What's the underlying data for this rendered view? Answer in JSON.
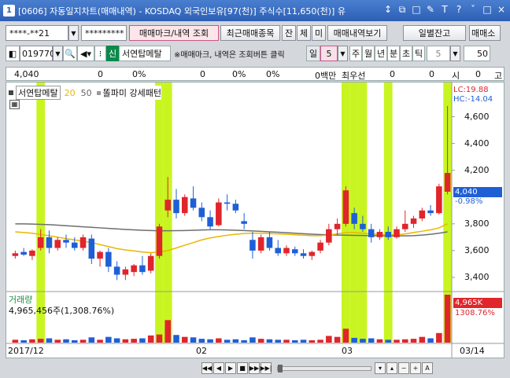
{
  "window": {
    "number": "1",
    "title": "[0606] 자동일지차트(매매내역) - KOSDAQ 외국인보유[97(천)] 주식수[11,650(천)] 유",
    "controls": [
      "↕",
      "⧉",
      "□",
      "✎",
      "T",
      "?",
      "ˇ",
      "□",
      "×"
    ]
  },
  "toolbar1": {
    "account": "****-**21",
    "password": "*********",
    "trade_mark_btn": "매매마크/내역 조회",
    "recent_btn": "최근매매종목",
    "small_btns": [
      "잔",
      "체",
      "미"
    ],
    "trade_list_btn": "매매내역보기",
    "daily_btn": "일별잔고",
    "trade_btn2": "매매소"
  },
  "toolbar2": {
    "code": "019770",
    "badge": "신",
    "name": "서연탑메탈",
    "hint": "※매매마크, 내역은 조회버튼 클릭",
    "period_label": "일",
    "period_value": "5",
    "periods": [
      "주",
      "월",
      "년",
      "분",
      "초",
      "틱"
    ],
    "tick_value": "5",
    "count": "50"
  },
  "infobar": {
    "price": "4,040",
    "v1": "0",
    "p1": "0%",
    "v2": "0",
    "p2": "0%",
    "p3": "0%",
    "unit": "0백만",
    "label": "최우선",
    "v3": "0",
    "v4": "0",
    "lbl_si": "시",
    "v5": "0",
    "lbl_go": "고"
  },
  "legend": {
    "name": "서연탑메탈",
    "ma20": "20",
    "ma50": "50",
    "pattern": "똘파미 강세패턴"
  },
  "price_axis": {
    "ticks": [
      "4,600",
      "4,400",
      "4,200",
      "3,800",
      "3,600",
      "3,400"
    ],
    "lc": "LC:19.88",
    "hc": "HC:-14.04",
    "current": "4,040",
    "change": "-0.98%"
  },
  "volume": {
    "title": "거래량",
    "value": "4,965,456주(1,308.76%)",
    "axis_value": "4,965K",
    "axis_pct": "1308.76%"
  },
  "date_axis": {
    "labels": [
      "2017/12",
      "02",
      "03"
    ],
    "end_label": "03/14"
  },
  "colors": {
    "up": "#e0252b",
    "down": "#1f5fd6",
    "highlight": "#c8f521",
    "ma20": "#e8b800",
    "ma50": "#6e6e6e"
  },
  "chart_data": {
    "type": "candlestick",
    "ylim": [
      3300,
      4750
    ],
    "candles": [
      {
        "o": 3560,
        "h": 3600,
        "l": 3540,
        "c": 3580,
        "v": 60
      },
      {
        "o": 3590,
        "h": 3620,
        "l": 3560,
        "c": 3570,
        "v": 50
      },
      {
        "o": 3560,
        "h": 3610,
        "l": 3530,
        "c": 3600,
        "v": 70
      },
      {
        "o": 3620,
        "h": 3760,
        "l": 3600,
        "c": 3700,
        "v": 80
      },
      {
        "o": 3700,
        "h": 3750,
        "l": 3580,
        "c": 3620,
        "v": 90
      },
      {
        "o": 3620,
        "h": 3700,
        "l": 3600,
        "c": 3680,
        "v": 60
      },
      {
        "o": 3680,
        "h": 3720,
        "l": 3620,
        "c": 3660,
        "v": 70
      },
      {
        "o": 3660,
        "h": 3700,
        "l": 3600,
        "c": 3620,
        "v": 50
      },
      {
        "o": 3620,
        "h": 3720,
        "l": 3600,
        "c": 3700,
        "v": 60
      },
      {
        "o": 3690,
        "h": 3720,
        "l": 3500,
        "c": 3540,
        "v": 110
      },
      {
        "o": 3540,
        "h": 3600,
        "l": 3480,
        "c": 3590,
        "v": 60
      },
      {
        "o": 3590,
        "h": 3620,
        "l": 3440,
        "c": 3480,
        "v": 120
      },
      {
        "o": 3480,
        "h": 3520,
        "l": 3380,
        "c": 3420,
        "v": 90
      },
      {
        "o": 3420,
        "h": 3480,
        "l": 3380,
        "c": 3460,
        "v": 70
      },
      {
        "o": 3440,
        "h": 3500,
        "l": 3410,
        "c": 3490,
        "v": 80
      },
      {
        "o": 3490,
        "h": 3560,
        "l": 3420,
        "c": 3440,
        "v": 90
      },
      {
        "o": 3450,
        "h": 3580,
        "l": 3430,
        "c": 3560,
        "v": 150
      },
      {
        "o": 3560,
        "h": 3800,
        "l": 3540,
        "c": 3780,
        "v": 170
      },
      {
        "o": 3900,
        "h": 4150,
        "l": 3850,
        "c": 3980,
        "v": 470
      },
      {
        "o": 3980,
        "h": 4060,
        "l": 3840,
        "c": 3880,
        "v": 160
      },
      {
        "o": 3880,
        "h": 4020,
        "l": 3860,
        "c": 4000,
        "v": 120
      },
      {
        "o": 3990,
        "h": 4080,
        "l": 3900,
        "c": 3920,
        "v": 110
      },
      {
        "o": 3920,
        "h": 3960,
        "l": 3820,
        "c": 3850,
        "v": 80
      },
      {
        "o": 3850,
        "h": 3900,
        "l": 3760,
        "c": 3780,
        "v": 70
      },
      {
        "o": 3790,
        "h": 3990,
        "l": 3780,
        "c": 3960,
        "v": 90
      },
      {
        "o": 3960,
        "h": 4020,
        "l": 3900,
        "c": 3950,
        "v": 60
      },
      {
        "o": 3950,
        "h": 3980,
        "l": 3880,
        "c": 3900,
        "v": 70
      },
      {
        "o": 3820,
        "h": 3880,
        "l": 3760,
        "c": 3800,
        "v": 50
      },
      {
        "o": 3680,
        "h": 3740,
        "l": 3540,
        "c": 3600,
        "v": 110
      },
      {
        "o": 3600,
        "h": 3720,
        "l": 3580,
        "c": 3700,
        "v": 80
      },
      {
        "o": 3700,
        "h": 3740,
        "l": 3600,
        "c": 3620,
        "v": 70
      },
      {
        "o": 3620,
        "h": 3680,
        "l": 3560,
        "c": 3580,
        "v": 60
      },
      {
        "o": 3580,
        "h": 3640,
        "l": 3560,
        "c": 3620,
        "v": 60
      },
      {
        "o": 3610,
        "h": 3630,
        "l": 3560,
        "c": 3580,
        "v": 50
      },
      {
        "o": 3580,
        "h": 3610,
        "l": 3540,
        "c": 3560,
        "v": 60
      },
      {
        "o": 3560,
        "h": 3600,
        "l": 3530,
        "c": 3590,
        "v": 50
      },
      {
        "o": 3600,
        "h": 3680,
        "l": 3580,
        "c": 3660,
        "v": 60
      },
      {
        "o": 3660,
        "h": 3800,
        "l": 3640,
        "c": 3760,
        "v": 140
      },
      {
        "o": 3760,
        "h": 3840,
        "l": 3720,
        "c": 3800,
        "v": 120
      },
      {
        "o": 3800,
        "h": 4080,
        "l": 3780,
        "c": 4050,
        "v": 290
      },
      {
        "o": 3880,
        "h": 3920,
        "l": 3760,
        "c": 3800,
        "v": 100
      },
      {
        "o": 3800,
        "h": 3860,
        "l": 3740,
        "c": 3760,
        "v": 80
      },
      {
        "o": 3760,
        "h": 3800,
        "l": 3660,
        "c": 3700,
        "v": 90
      },
      {
        "o": 3700,
        "h": 3760,
        "l": 3680,
        "c": 3740,
        "v": 70
      },
      {
        "o": 3740,
        "h": 3780,
        "l": 3680,
        "c": 3700,
        "v": 60
      },
      {
        "o": 3700,
        "h": 3780,
        "l": 3690,
        "c": 3760,
        "v": 60
      },
      {
        "o": 3760,
        "h": 3900,
        "l": 3740,
        "c": 3800,
        "v": 70
      },
      {
        "o": 3800,
        "h": 3860,
        "l": 3770,
        "c": 3840,
        "v": 80
      },
      {
        "o": 3840,
        "h": 3920,
        "l": 3820,
        "c": 3900,
        "v": 120
      },
      {
        "o": 3900,
        "h": 3940,
        "l": 3860,
        "c": 3880,
        "v": 90
      },
      {
        "o": 3880,
        "h": 4100,
        "l": 3870,
        "c": 4080,
        "v": 200
      },
      {
        "o": 4040,
        "h": 4680,
        "l": 4020,
        "c": 4180,
        "v": 1000
      }
    ],
    "ma20": [
      3740,
      3735,
      3730,
      3720,
      3712,
      3700,
      3690,
      3680,
      3670,
      3660,
      3645,
      3630,
      3615,
      3605,
      3598,
      3590,
      3585,
      3590,
      3600,
      3620,
      3640,
      3660,
      3680,
      3695,
      3705,
      3715,
      3722,
      3728,
      3730,
      3730,
      3728,
      3725,
      3722,
      3718,
      3715,
      3712,
      3712,
      3716,
      3725,
      3735,
      3735,
      3730,
      3725,
      3720,
      3718,
      3718,
      3725,
      3735,
      3745,
      3755,
      3770,
      3800
    ],
    "ma50": [
      3800,
      3800,
      3798,
      3796,
      3794,
      3790,
      3786,
      3782,
      3778,
      3774,
      3770,
      3766,
      3762,
      3758,
      3755,
      3752,
      3750,
      3748,
      3748,
      3749,
      3750,
      3752,
      3754,
      3756,
      3756,
      3754,
      3752,
      3750,
      3747,
      3744,
      3740,
      3737,
      3734,
      3730,
      3726,
      3723,
      3720,
      3718,
      3716,
      3715,
      3714,
      3713,
      3712,
      3711,
      3710,
      3710,
      3710,
      3712,
      3716,
      3722,
      3730,
      3740
    ],
    "highlights": [
      3,
      17,
      18,
      39,
      40,
      41,
      44,
      51
    ]
  },
  "nav": {
    "btns": [
      "◀◀",
      "◀",
      "▶",
      "■",
      "▶▶",
      "▶▶|"
    ]
  }
}
